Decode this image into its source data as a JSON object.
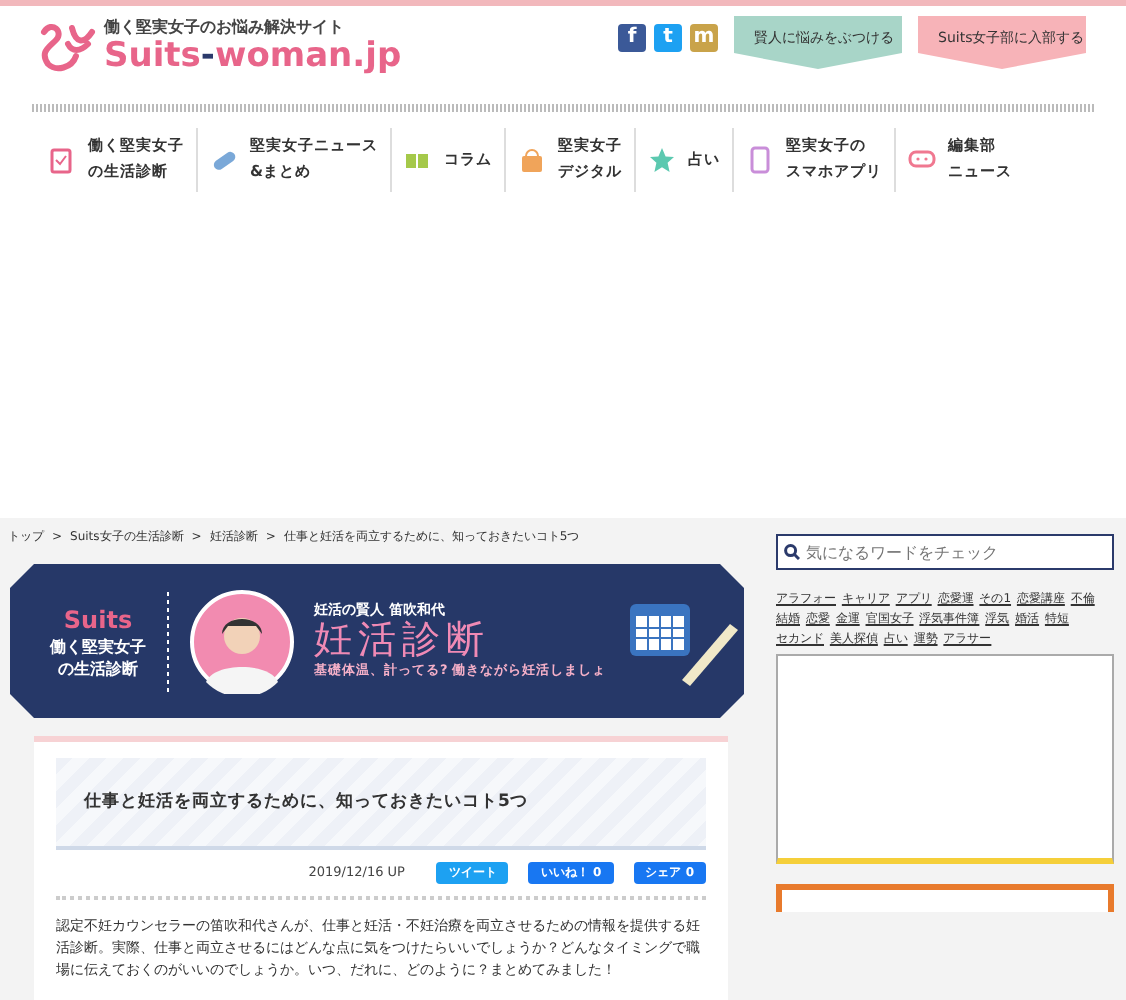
{
  "header": {
    "tagline": "働く堅実女子のお悩み解決サイト",
    "logo": {
      "main": "Suits",
      "separator": "-",
      "rest": "woman.jp"
    },
    "social": [
      {
        "kind": "facebook",
        "glyph": "f"
      },
      {
        "kind": "twitter",
        "glyph": "t"
      },
      {
        "kind": "mixi",
        "glyph": "m"
      }
    ],
    "ribbons": [
      {
        "label": "賢人に悩みをぶつける",
        "color": "#a8d5c8"
      },
      {
        "label": "Suits女子部に入部する",
        "color": "#f7b3b8"
      }
    ]
  },
  "nav": [
    {
      "lines": [
        "働く堅実女子",
        "の生活診断"
      ],
      "color": "#e8658a"
    },
    {
      "lines": [
        "堅実女子ニュース",
        "&まとめ"
      ],
      "color": "#7aa8d8"
    },
    {
      "lines": [
        "コラム"
      ],
      "color": "#a5c94a"
    },
    {
      "lines": [
        "堅実女子",
        "デジタル"
      ],
      "color": "#f0a45a"
    },
    {
      "lines": [
        "占い"
      ],
      "color": "#5cc9b0"
    },
    {
      "lines": [
        "堅実女子の",
        "スマホアプリ"
      ],
      "color": "#c98ed9"
    },
    {
      "lines": [
        "編集部",
        "ニュース"
      ],
      "color": "#f07890"
    }
  ],
  "breadcrumb": {
    "separator": ">",
    "items": [
      "トップ",
      "Suits女子の生活診断",
      "妊活診断",
      "仕事と妊活を両立するために、知っておきたいコト5つ"
    ]
  },
  "banner": {
    "brand": "Suits",
    "series": [
      "働く堅実女子",
      "の生活診断"
    ],
    "expert": "妊活の賢人 笛吹和代",
    "title": "妊活診断",
    "subtitle": "基礎体温、計ってる? 働きながら妊活しましょ"
  },
  "article": {
    "title": "仕事と妊活を両立するために、知っておきたいコト5つ",
    "date": "2019/12/16 UP",
    "share": [
      {
        "kind": "tweet",
        "label": "ツイート"
      },
      {
        "kind": "like",
        "label": "いいね！ 0"
      },
      {
        "kind": "share",
        "label": "シェア 0"
      }
    ],
    "lead": "認定不妊カウンセラーの笛吹和代さんが、仕事と妊活・不妊治療を両立させるための情報を提供する妊活診断。実際、仕事と両立させるにはどんな点に気をつけたらいいでしょうか？どんなタイミングで職場に伝えておくのがいいのでしょうか。いつ、だれに、どのように？まとめてみました！"
  },
  "sidebar": {
    "search": {
      "placeholder": "気になるワードをチェック"
    },
    "tags": [
      "アラフォー",
      "キャリア",
      "アプリ",
      "恋愛運",
      "その1",
      "恋愛講座",
      "不倫",
      "結婚",
      "恋愛",
      "金運",
      "官国女子",
      "浮気事件簿",
      "浮気",
      "婚活",
      "特短",
      "セカンド",
      "美人探偵",
      "占い",
      "運勢",
      "アラサー"
    ]
  }
}
